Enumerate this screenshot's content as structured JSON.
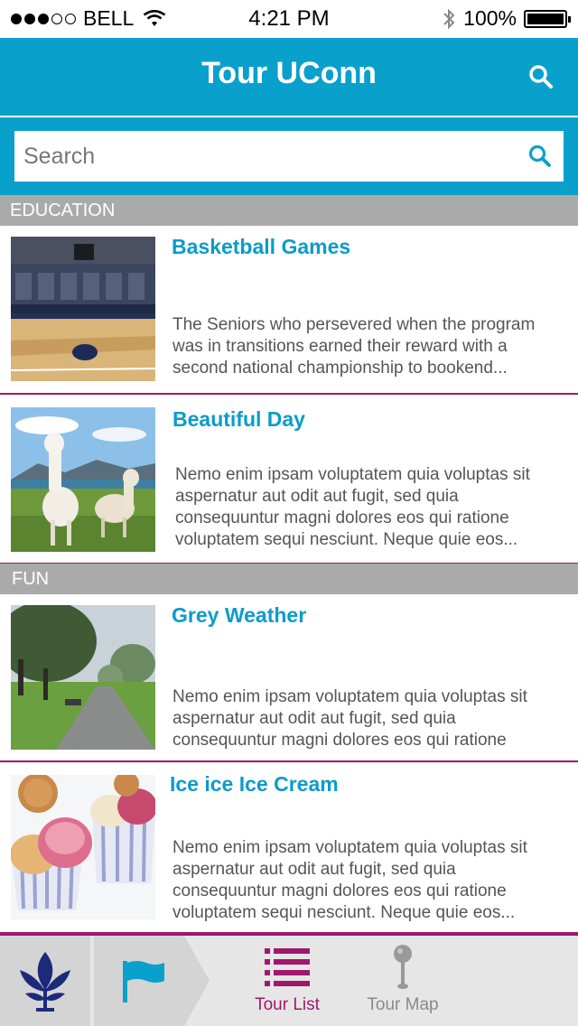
{
  "status_bar": {
    "carrier": "BELL",
    "time": "4:21 PM",
    "battery": "100%"
  },
  "header": {
    "title": "Tour UConn"
  },
  "search": {
    "placeholder": "Search"
  },
  "sections": [
    {
      "title": "EDUCATION",
      "items": [
        {
          "title": "Basketball Games",
          "description": "The Seniors who persevered when the program was in transitions earned their reward with a second national championship to bookend...",
          "image": "basketball-arena-photo"
        },
        {
          "title": "Beautiful Day",
          "description": "Nemo enim ipsam voluptatem quia voluptas sit aspernatur aut odit aut fugit, sed quia consequuntur magni dolores eos qui ratione voluptatem sequi nesciunt. Neque quie eos...",
          "image": "alpacas-photo"
        }
      ]
    },
    {
      "title": "FUN",
      "items": [
        {
          "title": "Grey Weather",
          "description": "Nemo enim ipsam voluptatem quia voluptas sit aspernatur aut odit aut fugit, sed quia consequuntur magni dolores eos qui ratione",
          "image": "park-path-photo"
        },
        {
          "title": "Ice ice Ice Cream",
          "description": "Nemo enim ipsam voluptatem quia voluptas sit aspernatur aut odit aut fugit, sed quia consequuntur magni dolores eos qui ratione voluptatem sequi nesciunt. Neque quie eos...",
          "image": "ice-cream-photo"
        }
      ]
    }
  ],
  "tab_bar": {
    "tabs": [
      {
        "label": "Tour List",
        "icon": "list-icon",
        "active": true
      },
      {
        "label": "Tour Map",
        "icon": "map-pin-icon",
        "active": false
      }
    ]
  },
  "colors": {
    "brand": "#0aa0cc",
    "accent": "#a0186e",
    "section": "#aaaaaa"
  }
}
